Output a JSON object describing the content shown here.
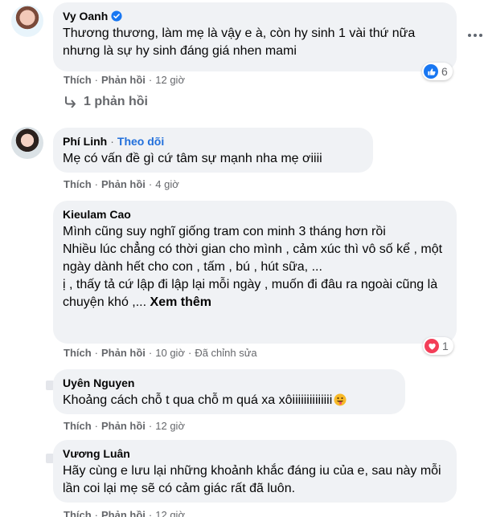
{
  "comments": [
    {
      "author": "Vy Oanh",
      "verified": true,
      "text": "Thương thương, làm mẹ là vậy e à, còn hy sinh 1 vài thứ nữa nhưng là sự hy sinh đáng giá nhen mami",
      "like": "Thích",
      "reply": "Phản hồi",
      "time": "12 giờ",
      "reaction": {
        "icon": "like-icon",
        "count": "6",
        "color": "#1877f2"
      },
      "replies_label": "1 phản hồi"
    },
    {
      "author": "Phí Linh",
      "follow": "Theo dõi",
      "text": "Mẹ có vấn đề gì cứ tâm sự mạnh nha mẹ ơiiii",
      "like": "Thích",
      "reply": "Phản hồi",
      "time": "4 giờ"
    },
    {
      "author": "Kieulam Cao",
      "text": "Mình cũng suy nghĩ giống tram con minh 3 tháng hơn rồi\nNhiều lúc chẳng có thời gian cho mình , cảm xúc thì vô số kể , một ngày dành hết cho con , tấm , bú , hút sữa, ...\nị , thấy tả cứ lập đi lập lại mỗi ngày , muốn đi đâu ra ngoài cũng là chuyện khó ,...",
      "see_more": "Xem thêm",
      "like": "Thích",
      "reply": "Phản hồi",
      "time": "10 giờ",
      "edited": "Đã chỉnh sửa",
      "reaction": {
        "icon": "heart-icon",
        "count": "1",
        "color": "#f33e58"
      }
    },
    {
      "author": "Uyên Nguyen",
      "text": "Khoảng cách chỗ t qua chỗ m quá xa xôiiiiiiiiiiiiii",
      "emoji": "grinning-tongue-emoji",
      "like": "Thích",
      "reply": "Phản hồi",
      "time": "12 giờ"
    },
    {
      "author": "Vương Luân",
      "text": "Hãy cùng e lưu lại những khoảnh khắc đáng iu của e, sau này mỗi lần coi lại mẹ sẽ có cảm giác rất đã luôn.",
      "like": "Thích",
      "reply": "Phản hồi",
      "time": "12 giờ"
    }
  ]
}
